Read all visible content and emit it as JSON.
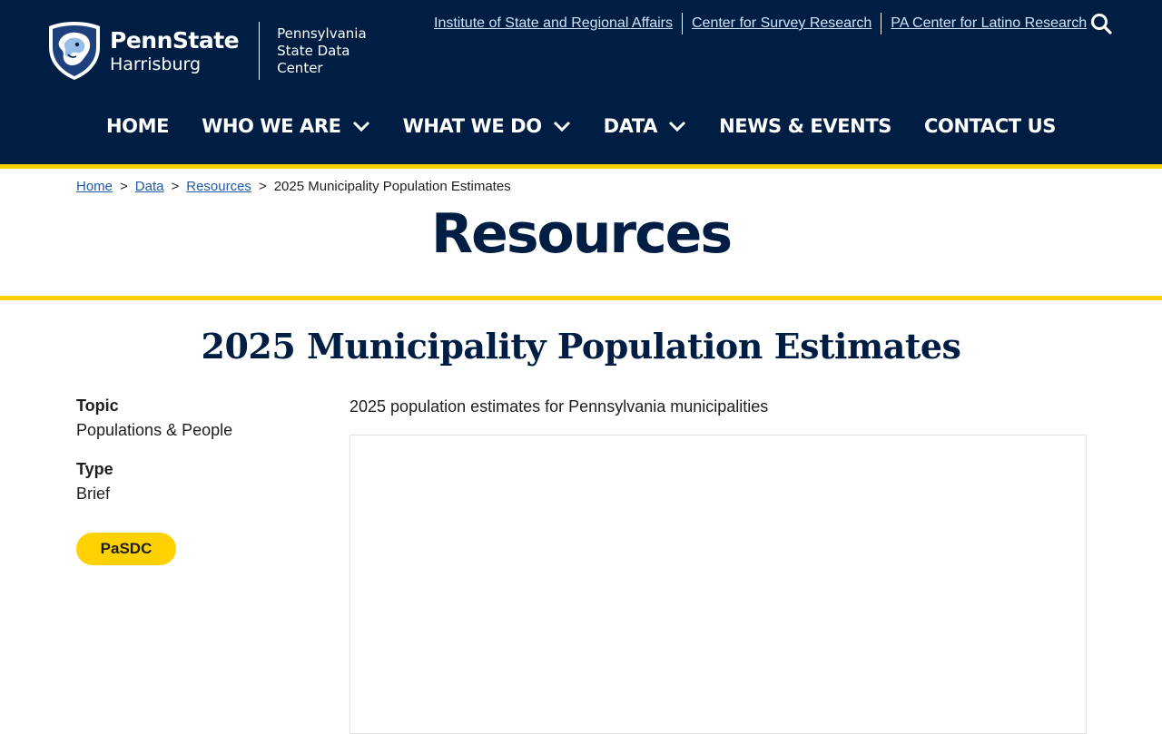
{
  "header": {
    "logo": {
      "brand": "PennState",
      "campus": "Harrisburg",
      "unit_line1": "Pennsylvania",
      "unit_line2": "State Data Center"
    },
    "top_links": [
      {
        "label": "Institute of State and Regional Affairs"
      },
      {
        "label": "Center for Survey Research"
      },
      {
        "label": "PA Center for Latino Research"
      }
    ],
    "search_icon": "search-icon",
    "nav": [
      {
        "label": "HOME",
        "has_dropdown": false
      },
      {
        "label": "WHO WE ARE",
        "has_dropdown": true
      },
      {
        "label": "WHAT WE DO",
        "has_dropdown": true
      },
      {
        "label": "DATA",
        "has_dropdown": true
      },
      {
        "label": "NEWS & EVENTS",
        "has_dropdown": false
      },
      {
        "label": "CONTACT US",
        "has_dropdown": false
      }
    ]
  },
  "breadcrumb": {
    "items": [
      {
        "label": "Home"
      },
      {
        "label": "Data"
      },
      {
        "label": "Resources"
      }
    ],
    "separator": ">",
    "current": "2025 Municipality Population Estimates"
  },
  "hero": {
    "title": "Resources"
  },
  "main": {
    "title": "2025 Municipality Population Estimates",
    "topic_label": "Topic",
    "topic_value": "Populations & People",
    "type_label": "Type",
    "type_value": "Brief",
    "tag": "PaSDC",
    "description": "2025 population estimates for Pennsylvania municipalities"
  },
  "colors": {
    "navy": "#001e44",
    "gold": "#ffd100",
    "link": "#1e5ba8",
    "toplink": "#cfe3ff"
  }
}
